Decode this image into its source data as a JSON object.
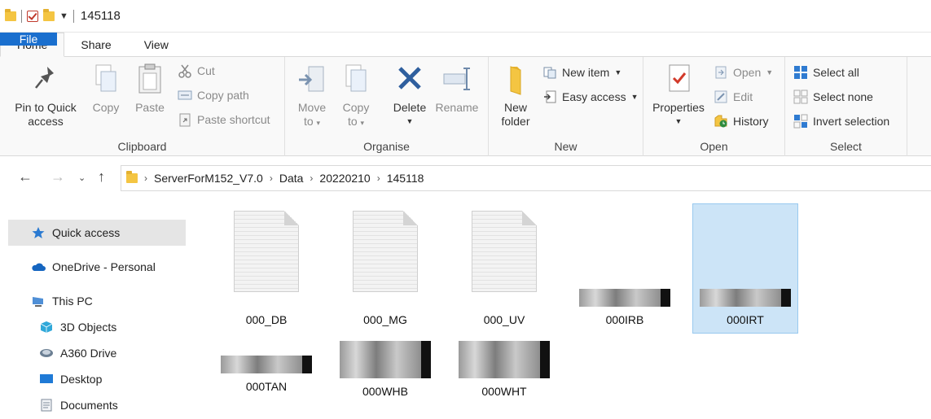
{
  "window": {
    "title": "145118"
  },
  "tabs": [
    {
      "label": "File"
    },
    {
      "label": "Home"
    },
    {
      "label": "Share"
    },
    {
      "label": "View"
    }
  ],
  "ribbon": {
    "clipboard": {
      "label": "Clipboard",
      "pin_line1": "Pin to Quick",
      "pin_line2": "access",
      "copy": "Copy",
      "paste": "Paste",
      "cut": "Cut",
      "copy_path": "Copy path",
      "paste_shortcut": "Paste shortcut"
    },
    "organise": {
      "label": "Organise",
      "move_line1": "Move",
      "move_line2": "to",
      "copy_line1": "Copy",
      "copy_line2": "to",
      "delete": "Delete",
      "rename": "Rename"
    },
    "new": {
      "label": "New",
      "new_folder_line1": "New",
      "new_folder_line2": "folder",
      "new_item": "New item",
      "easy_access": "Easy access"
    },
    "open": {
      "label": "Open",
      "properties": "Properties",
      "open": "Open",
      "edit": "Edit",
      "history": "History"
    },
    "select": {
      "label": "Select",
      "select_all": "Select all",
      "select_none": "Select none",
      "invert_selection": "Invert selection"
    }
  },
  "breadcrumb": [
    "ServerForM152_V7.0",
    "Data",
    "20220210",
    "145118"
  ],
  "nav": {
    "quick_access": "Quick access",
    "onedrive": "OneDrive - Personal",
    "this_pc": "This PC",
    "objects_3d": "3D Objects",
    "a360": "A360 Drive",
    "desktop": "Desktop",
    "documents": "Documents"
  },
  "files": [
    {
      "name": "000_DB",
      "kind": "document"
    },
    {
      "name": "000_MG",
      "kind": "document"
    },
    {
      "name": "000_UV",
      "kind": "document"
    },
    {
      "name": "000IRB",
      "kind": "image"
    },
    {
      "name": "000IRT",
      "kind": "image",
      "selected": true
    },
    {
      "name": "000TAN",
      "kind": "image"
    },
    {
      "name": "000WHB",
      "kind": "image"
    },
    {
      "name": "000WHT",
      "kind": "image"
    }
  ],
  "colors": {
    "accent": "#1a6fce",
    "selection_bg": "#cce4f7",
    "selection_border": "#99c9ef",
    "folder": "#f4c542"
  }
}
